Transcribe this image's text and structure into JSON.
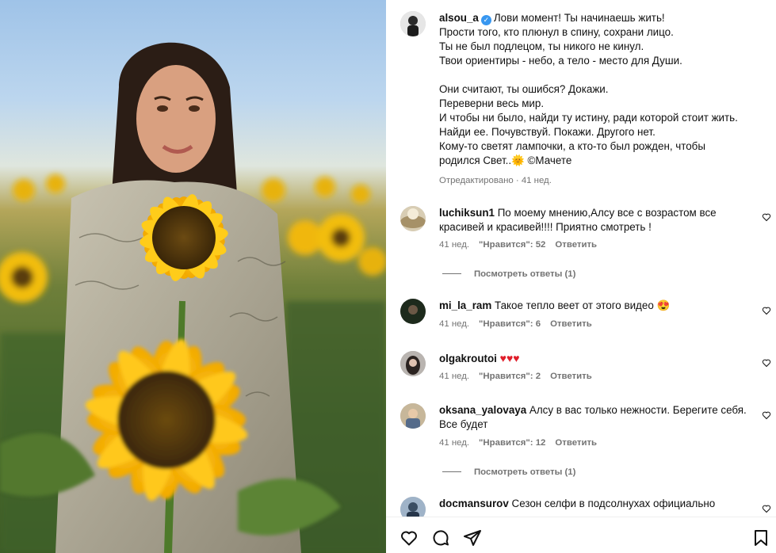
{
  "post": {
    "author": "alsou_a",
    "caption_lines": [
      "Лови момент! Ты начинаешь жить!",
      "Прости того, кто плюнул в спину, сохрани лицо.",
      "Ты не был подлецом, ты никого не кинул.",
      "Твои ориентиры - небо, а тело - место для Души.",
      "",
      "Они считают, ты ошибся? Докажи.",
      "Переверни весь мир.",
      "И чтобы ни было, найди ту истину, ради которой стоит жить.",
      "Найди ее. Почувствуй. Покажи. Другого нет.",
      "Кому-то светят лампочки, а кто-то был рожден, чтобы",
      "родился Свет.."
    ],
    "caption_emoji": "🌞",
    "caption_tail": "©Мачете",
    "edited": "Отредактировано · 41 нед."
  },
  "comments": [
    {
      "user": "luchiksun1",
      "text": "По моему мнению,Алсу все с возрастом все красивей и красивей!!!! Приятно смотреть !",
      "age": "41 нед.",
      "likes": "\"Нравится\": 52",
      "reply": "Ответить",
      "view_replies": "Посмотреть ответы (1)"
    },
    {
      "user": "mi_la_ram",
      "text": "Такое тепло веет от этого видео 😍",
      "age": "41 нед.",
      "likes": "\"Нравится\": 6",
      "reply": "Ответить"
    },
    {
      "user": "olgakroutoi",
      "text": "♥♥♥",
      "age": "41 нед.",
      "likes": "\"Нравится\": 2",
      "reply": "Ответить"
    },
    {
      "user": "oksana_yalovaya",
      "text": "Алсу в вас только нежности. Берегите себя. Все будет",
      "age": "41 нед.",
      "likes": "\"Нравится\": 12",
      "reply": "Ответить",
      "view_replies": "Посмотреть ответы (1)"
    },
    {
      "user": "docmansurov",
      "text": "Сезон селфи в подсолнухах официально"
    }
  ],
  "icons": {
    "like": "heart-icon",
    "comment": "comment-icon",
    "share": "share-icon",
    "save": "bookmark-icon",
    "verified": "verified-badge-icon"
  },
  "colors": {
    "verified": "#3897f0",
    "muted": "#737373",
    "heart_emoji": "#e01e2a"
  }
}
